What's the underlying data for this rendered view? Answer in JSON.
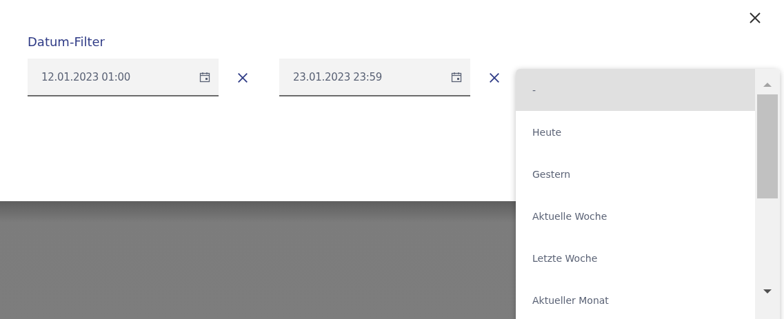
{
  "dialog": {
    "title": "Datum-Filter"
  },
  "date_fields": [
    {
      "value": "12.01.2023 01:00"
    },
    {
      "value": "23.01.2023 23:59"
    }
  ],
  "quick_select": {
    "options": [
      {
        "label": "-",
        "selected": true
      },
      {
        "label": "Heute",
        "selected": false
      },
      {
        "label": "Gestern",
        "selected": false
      },
      {
        "label": "Aktuelle Woche",
        "selected": false
      },
      {
        "label": "Letzte Woche",
        "selected": false
      },
      {
        "label": "Aktueller Monat",
        "selected": false
      }
    ]
  }
}
